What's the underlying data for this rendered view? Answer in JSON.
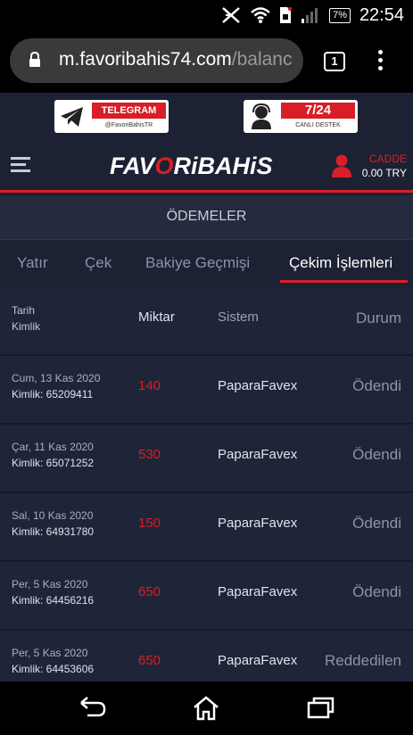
{
  "status": {
    "battery": "7%",
    "time": "22:54"
  },
  "browser": {
    "url_host": "m.favoribahis74.com",
    "url_path": "/balanc",
    "tab_count": "1"
  },
  "promo": {
    "telegram_title": "TELEGRAM",
    "telegram_handle": "@FavoriBahisTR",
    "support_title": "7/24",
    "support_sub": "CANLI DESTEK"
  },
  "header": {
    "logo_part1": "FAV",
    "logo_o": "O",
    "logo_part2": "RiBAHiS",
    "username": "CADDE",
    "balance": "0.00 TRY"
  },
  "section_title": "ÖDEMELER",
  "tabs": [
    {
      "label": "Yatır"
    },
    {
      "label": "Çek"
    },
    {
      "label": "Bakiye Geçmişi"
    },
    {
      "label": "Çekim İşlemleri"
    }
  ],
  "table": {
    "headers": {
      "date": "Tarih",
      "id": "Kimlik",
      "amount": "Miktar",
      "system": "Sistem",
      "status": "Durum"
    },
    "rows": [
      {
        "date": "Cum, 13 Kas 2020",
        "id": "Kimlik: 65209411",
        "amount": "140",
        "system": "PaparaFavex",
        "status": "Ödendi"
      },
      {
        "date": "Çar, 11 Kas 2020",
        "id": "Kimlik: 65071252",
        "amount": "530",
        "system": "PaparaFavex",
        "status": "Ödendi"
      },
      {
        "date": "Sal, 10 Kas 2020",
        "id": "Kimlik: 64931780",
        "amount": "150",
        "system": "PaparaFavex",
        "status": "Ödendi"
      },
      {
        "date": "Per, 5 Kas 2020",
        "id": "Kimlik: 64456216",
        "amount": "650",
        "system": "PaparaFavex",
        "status": "Ödendi"
      },
      {
        "date": "Per, 5 Kas 2020",
        "id": "Kimlik: 64453606",
        "amount": "650",
        "system": "PaparaFavex",
        "status": "Reddedilen"
      }
    ]
  },
  "colors": {
    "accent": "#d81e27",
    "background": "#1c2233",
    "row_background": "#1e2538"
  },
  "icons": [
    "no-sim-icon",
    "wifi-icon",
    "sim-icon",
    "signal-icon",
    "battery-icon",
    "lock-icon",
    "tabs-icon",
    "menu-dots-icon",
    "telegram-icon",
    "support-agent-icon",
    "hamburger-icon",
    "user-icon",
    "back-icon",
    "home-icon",
    "recents-icon"
  ]
}
